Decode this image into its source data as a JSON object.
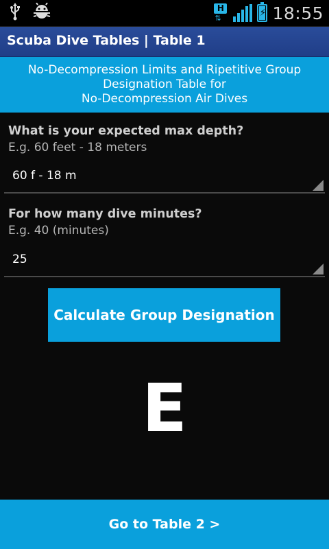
{
  "status_bar": {
    "time": "18:55",
    "network_label": "H",
    "icons": [
      "usb-icon",
      "android-debug-icon",
      "hspa-icon",
      "signal-icon",
      "battery-charging-icon"
    ]
  },
  "action_bar": {
    "title": "Scuba Dive Tables | Table 1"
  },
  "banner": {
    "lines": [
      "No-Decompression Limits and Ripetitive Group",
      "Designation Table for",
      "No-Decompression Air Dives"
    ]
  },
  "form": {
    "depth": {
      "question": "What is your expected max depth?",
      "hint": "E.g. 60 feet - 18 meters",
      "selected": "60 f - 18 m"
    },
    "minutes": {
      "question": "For how many dive minutes?",
      "hint": "E.g. 40 (minutes)",
      "selected": "25"
    },
    "calculate_label": "Calculate Group Designation"
  },
  "result": {
    "group": "E"
  },
  "footer": {
    "next_label": "Go to Table 2 >"
  },
  "colors": {
    "accent": "#0aa0dc",
    "action_bar": "#2a4c9a",
    "background": "#0a0a0a"
  }
}
